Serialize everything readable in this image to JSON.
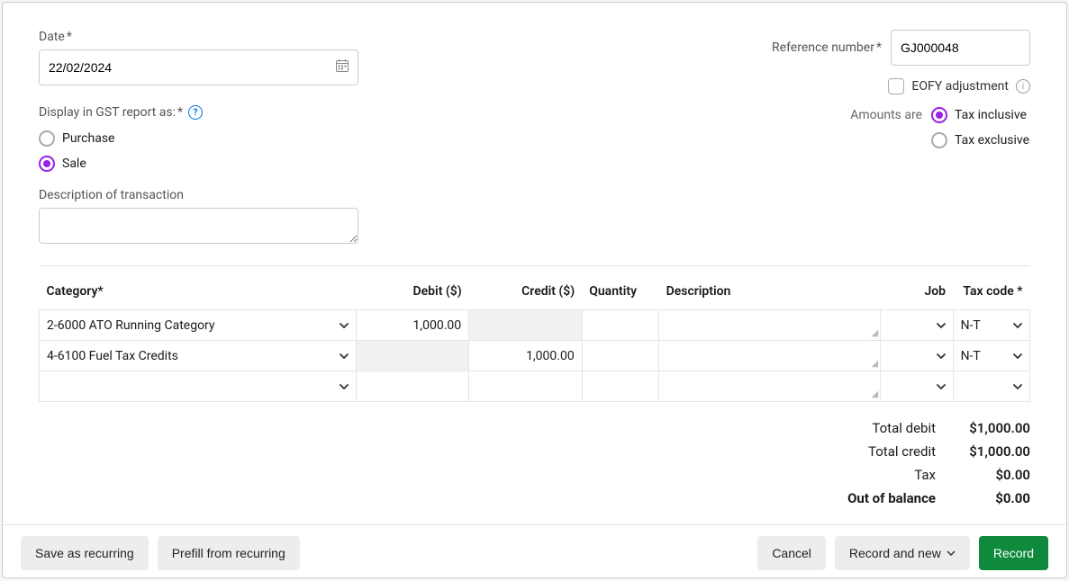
{
  "date": {
    "label": "Date",
    "value": "22/02/2024"
  },
  "reference": {
    "label": "Reference number",
    "value": "GJ000048"
  },
  "eofy": {
    "label": "EOFY adjustment"
  },
  "amounts": {
    "label": "Amounts are",
    "options": {
      "inclusive": "Tax inclusive",
      "exclusive": "Tax exclusive"
    },
    "selected": "inclusive"
  },
  "gst": {
    "label": "Display in GST report as:",
    "options": {
      "purchase": "Purchase",
      "sale": "Sale"
    },
    "selected": "sale"
  },
  "description": {
    "label": "Description of transaction",
    "value": ""
  },
  "table": {
    "headers": {
      "category": "Category*",
      "debit": "Debit ($)",
      "credit": "Credit ($)",
      "quantity": "Quantity",
      "description": "Description",
      "job": "Job",
      "tax_code": "Tax code *"
    },
    "rows": [
      {
        "category": "2-6000  ATO Running Category",
        "debit": "1,000.00",
        "credit": "",
        "quantity": "",
        "description": "",
        "job": "",
        "tax_code": "N-T"
      },
      {
        "category": "4-6100  Fuel Tax Credits",
        "debit": "",
        "credit": "1,000.00",
        "quantity": "",
        "description": "",
        "job": "",
        "tax_code": "N-T"
      },
      {
        "category": "",
        "debit": "",
        "credit": "",
        "quantity": "",
        "description": "",
        "job": "",
        "tax_code": ""
      }
    ]
  },
  "totals": {
    "total_debit": {
      "label": "Total debit",
      "value": "$1,000.00"
    },
    "total_credit": {
      "label": "Total credit",
      "value": "$1,000.00"
    },
    "tax": {
      "label": "Tax",
      "value": "$0.00"
    },
    "oob": {
      "label": "Out of balance",
      "value": "$0.00"
    }
  },
  "footer": {
    "save_recurring": "Save as recurring",
    "prefill_recurring": "Prefill from recurring",
    "cancel": "Cancel",
    "record_new": "Record and new",
    "record": "Record"
  }
}
